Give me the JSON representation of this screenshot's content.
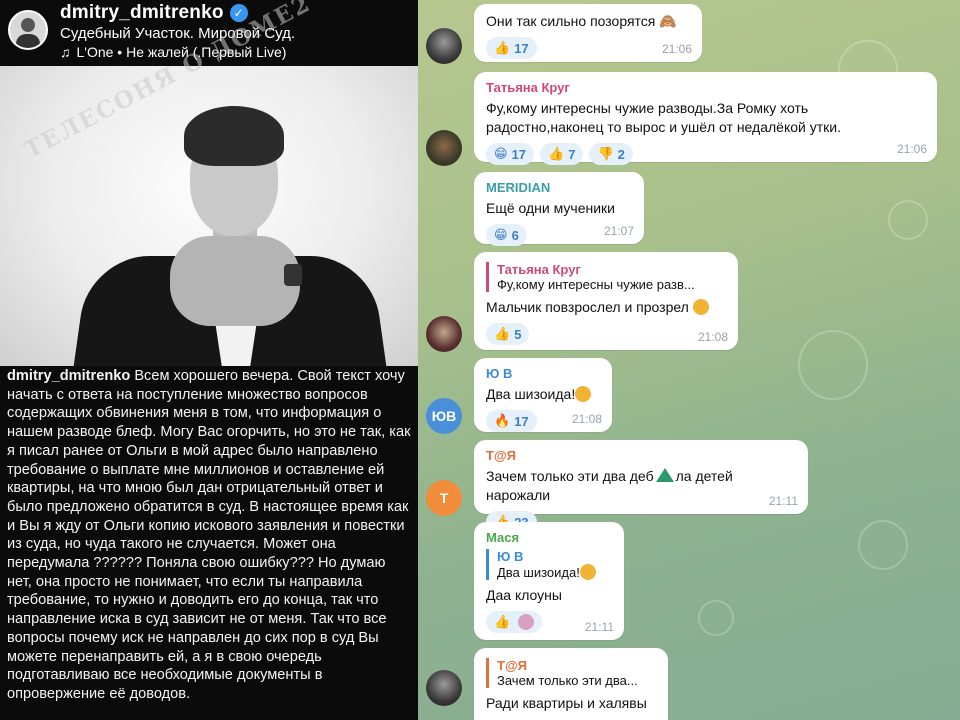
{
  "story": {
    "username": "dmitry_dmitrenko",
    "verified_icon": "verified-badge-icon",
    "subtitle": "Судебный Участок. Мировой Суд.",
    "music": "L'One • Не жалей (.Первый Live)",
    "watermark": "ТЕЛЕСОНЯ О ДОМЕ2",
    "post_author": "dmitry_dmitrenko",
    "post_text": " Всем хорошего вечера. Свой текст хочу начать с ответа на поступление множество вопросов содержащих обвинения меня в том, что информация о нашем разводе блеф. Могу Вас огорчить, но это не так, как я писал ранее от Ольги в мой адрес было направлено требование о выплате мне миллионов и оставление ей квартиры, на что мною был дан отрицательный ответ и было предложено обратится в суд. В настоящее время как и Вы я жду от Ольги копию искового заявления и повестки из суда, но чуда такого не случается. Может она передумала ?????? Поняла свою ошибку??? Но думаю нет, она просто не понимает, что если ты направила требование, то нужно и доводить его до конца, так что направление иска в суд зависит не от меня. Так что все вопросы почему иск не направлен до сих пор в суд Вы можете перенаправить ей, а я в свою очередь подготавливаю все необходимые документы в опровержение её доводов."
  },
  "chat": {
    "messages": [
      {
        "text": "Они так сильно позорятся 🙈",
        "reactions": [
          {
            "emoji": "👍",
            "count": "17"
          }
        ],
        "time": "21:06"
      },
      {
        "sender": "Татьяна Круг",
        "text": "Фу,кому интересны чужие разводы.За Ромку хоть радостно,наконец то вырос и ушёл от недалёкой утки.",
        "reactions": [
          {
            "emoji": "😁",
            "count": "17"
          },
          {
            "emoji": "👍",
            "count": "7"
          },
          {
            "emoji": "👎",
            "count": "2"
          }
        ],
        "time": "21:06"
      },
      {
        "sender": "MERIDIAN",
        "text": "Ещё одни мученики",
        "reactions": [
          {
            "emoji": "😁",
            "count": "6"
          }
        ],
        "time": "21:07"
      },
      {
        "reply_name": "Татьяна Круг",
        "reply_text": "Фу,кому интересны чужие разв...",
        "text": "Мальчик повзрослел и прозрел",
        "reactions": [
          {
            "emoji": "👍",
            "count": "5"
          }
        ],
        "time": "21:08"
      },
      {
        "sender": "Ю В",
        "avatar": "ЮВ",
        "text": "Два шизоида!",
        "reactions": [
          {
            "emoji": "🔥",
            "count": "17"
          }
        ],
        "time": "21:08"
      },
      {
        "sender": "Т@Я",
        "avatar": "Т",
        "text_a": "Зачем только эти два деб",
        "text_b": "ла детей нарожали",
        "reactions": [
          {
            "emoji": "👍",
            "count": "23"
          }
        ],
        "time": "21:11"
      },
      {
        "sender": "Мася",
        "reply_name": "Ю В",
        "reply_text": "Два шизоида!",
        "text": "Даа клоуны",
        "reactions": [
          {
            "emoji": "👍",
            "count": ""
          }
        ],
        "time": "21:11"
      },
      {
        "reply_name": "Т@Я",
        "reply_text": "Зачем только эти два...",
        "text": "Ради квартиры и халявы"
      }
    ]
  }
}
